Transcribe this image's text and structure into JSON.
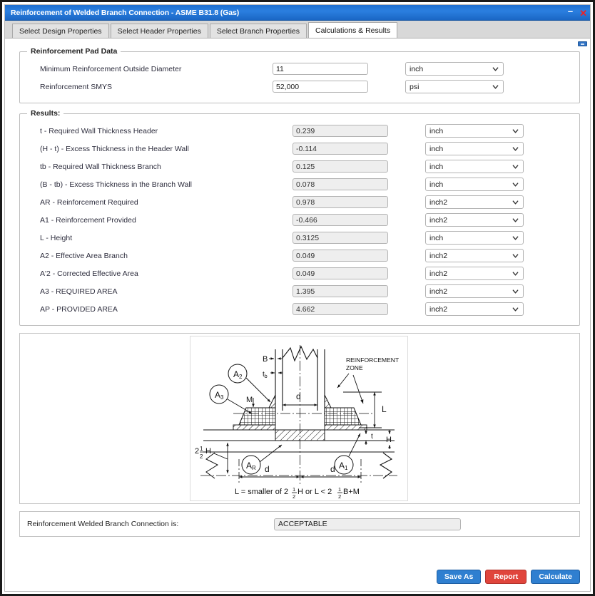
{
  "window": {
    "title": "Reinforcement of Welded Branch Connection - ASME B31.8 (Gas)",
    "minimize_glyph": "–",
    "close_glyph": "✕"
  },
  "tabs": [
    {
      "label": "Select Design Properties",
      "active": false
    },
    {
      "label": "Select Header Properties",
      "active": false
    },
    {
      "label": "Select Branch Properties",
      "active": false
    },
    {
      "label": "Calculations & Results",
      "active": true
    }
  ],
  "pad_data": {
    "legend": "Reinforcement Pad Data",
    "rows": [
      {
        "label": "Minimum Reinforcement Outside Diameter",
        "value": "11",
        "unit": "inch",
        "readonly": false
      },
      {
        "label": "Reinforcement SMYS",
        "value": "52,000",
        "unit": "psi",
        "readonly": false
      }
    ]
  },
  "results": {
    "legend": "Results:",
    "rows": [
      {
        "label": "t - Required Wall Thickness Header",
        "value": "0.239",
        "unit": "inch"
      },
      {
        "label": "(H - t) - Excess Thickness in the Header Wall",
        "value": "-0.114",
        "unit": "inch"
      },
      {
        "label": "tb - Required Wall Thickness Branch",
        "value": "0.125",
        "unit": "inch"
      },
      {
        "label": "(B - tb) - Excess Thickness in the Branch Wall",
        "value": "0.078",
        "unit": "inch"
      },
      {
        "label": "AR - Reinforcement Required",
        "value": "0.978",
        "unit": "inch2"
      },
      {
        "label": "A1 - Reinforcement Provided",
        "value": "-0.466",
        "unit": "inch2"
      },
      {
        "label": "L - Height",
        "value": "0.3125",
        "unit": "inch"
      },
      {
        "label": "A2 - Effective Area Branch",
        "value": "0.049",
        "unit": "inch2"
      },
      {
        "label": "A'2 - Corrected Effective Area",
        "value": "0.049",
        "unit": "inch2"
      },
      {
        "label": "A3 - REQUIRED AREA",
        "value": "1.395",
        "unit": "inch2"
      },
      {
        "label": "AP - PROVIDED AREA",
        "value": "4.662",
        "unit": "inch2"
      }
    ]
  },
  "diagram": {
    "labels": {
      "branch_thickness": "B",
      "branch_wall": "tb",
      "area_2": "A",
      "area_2_sub": "2",
      "area_3": "A",
      "area_3_sub": "3",
      "fillet": "M",
      "branch_diameter": "d",
      "reinforcement_zone": "REINFORCEMENT ZONE",
      "height_L": "L",
      "header_thickness": "t",
      "header_wall": "H",
      "area_R": "A",
      "area_R_sub": "R",
      "area_1": "A",
      "area_1_sub": "1",
      "two_half_H": "H",
      "half_d": "d"
    },
    "caption": "L = smaller of 2½H or L < 2½B+M"
  },
  "status": {
    "label": "Reinforcement Welded Branch Connection is:",
    "value": "ACCEPTABLE"
  },
  "buttons": [
    {
      "label": "Save As",
      "color": "blue"
    },
    {
      "label": "Report",
      "color": "red"
    },
    {
      "label": "Calculate",
      "color": "blue"
    }
  ],
  "colors": {
    "title_bar": "#2b7fe0",
    "accent_blue": "#2f7fd0",
    "accent_red": "#e0453c",
    "readonly_field": "#eeeeee"
  }
}
